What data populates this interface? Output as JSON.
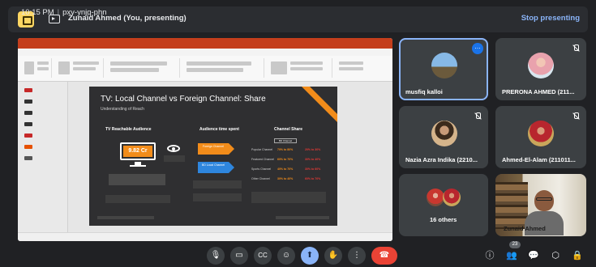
{
  "topbar": {
    "presenting_label": "Zunaid Ahmed (You, presenting)",
    "stop_label": "Stop presenting"
  },
  "slide": {
    "title": "TV: Local Channel vs Foreign Channel: Share",
    "subtitle": "Understanding of Reach",
    "col1_heading": "TV Reachable Audience",
    "col2_heading": "Audience time spent",
    "col3_heading": "Channel Share",
    "tv_value": "9.82 Cr",
    "foreign_label": "Foreign Channel",
    "local_label": "BD Local Channel",
    "channel_pill": "BD Channel",
    "share_rows": [
      {
        "label": "Popular Channel",
        "local": "70% to 80%",
        "foreign": "20% to 30%"
      },
      {
        "label": "Featured Channel",
        "local": "60% to 70%",
        "foreign": "30% to 40%"
      },
      {
        "label": "Sports Channel",
        "local": "40% to 70%",
        "foreign": "30% to 60%"
      },
      {
        "label": "Other Channel",
        "local": "30% to 40%",
        "foreign": "60% to 70%"
      }
    ]
  },
  "participants": [
    {
      "name": "musfiq kalloi",
      "avatar": "avatar-photo"
    },
    {
      "name": "PRERONA AHMED (211...",
      "avatar": "avatar-photo"
    },
    {
      "name": "Nazia Azra Indika (2210...",
      "avatar": "avatar-photo"
    },
    {
      "name": "Ahmed-El-Alam (211011...",
      "avatar": "avatar-photo"
    },
    {
      "name": "16 others",
      "avatar": "avatar-group"
    },
    {
      "name": "Zunaid Ahmed",
      "avatar": "camera-feed"
    }
  ],
  "bottombar": {
    "time": "10:15 PM",
    "meeting_code": "pxy-ynjq-phn",
    "participant_count": "23"
  },
  "colors": {
    "accent_blue": "#8ab4f8",
    "end_call_red": "#ea4335",
    "slide_orange": "#f28c1a"
  }
}
